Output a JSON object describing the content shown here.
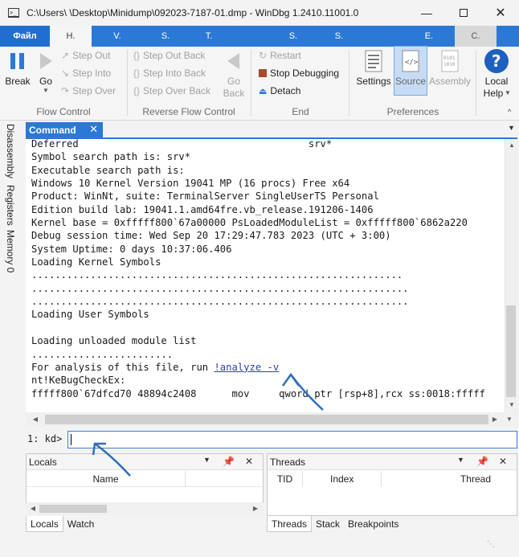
{
  "window": {
    "title": "C:\\Users\\        \\Desktop\\Minidump\\092023-7187-01.dmp - WinDbg 1.2410.11001.0"
  },
  "ribbon_tabs": {
    "file": "Файл",
    "tabs": [
      "Н.",
      "V.",
      "S.",
      "T.",
      "S.",
      "S.",
      "E.",
      "C."
    ]
  },
  "ribbon": {
    "flow_control": {
      "break": "Break",
      "go": "Go",
      "step_out": "Step Out",
      "step_into": "Step Into",
      "step_over": "Step Over",
      "group": "Flow Control"
    },
    "reverse_flow": {
      "step_out_back": "Step Out Back",
      "step_into_back": "Step Into Back",
      "step_over_back": "Step Over Back",
      "go_back_1": "Go",
      "go_back_2": "Back",
      "group": "Reverse Flow Control"
    },
    "end": {
      "restart": "Restart",
      "stop": "Stop Debugging",
      "detach": "Detach",
      "group": "End"
    },
    "preferences": {
      "settings": "Settings",
      "source": "Source",
      "assembly": "Assembly",
      "group": "Preferences"
    },
    "help": {
      "local_1": "Local",
      "local_2": "Help"
    }
  },
  "left_tabs": [
    "Disassembly",
    "Registers",
    "Memory 0"
  ],
  "command": {
    "tab_label": "Command",
    "lines": [
      "Deferred                                       srv*",
      "Symbol search path is: srv*",
      "Executable search path is:",
      "Windows 10 Kernel Version 19041 MP (16 procs) Free x64",
      "Product: WinNt, suite: TerminalServer SingleUserTS Personal",
      "Edition build lab: 19041.1.amd64fre.vb_release.191206-1406",
      "Kernel base = 0xfffff800`67a00000 PsLoadedModuleList = 0xfffff800`6862a220",
      "Debug session time: Wed Sep 20 17:29:47.783 2023 (UTC + 3:00)",
      "System Uptime: 0 days 10:37:06.406",
      "Loading Kernel Symbols",
      "...............................................................",
      "................................................................",
      "................................................................",
      "Loading User Symbols",
      "",
      "Loading unloaded module list",
      "........................"
    ],
    "analysis_prefix": "For analysis of this file, run ",
    "analysis_link": "!analyze -v",
    "bugcheck_line": "nt!KeBugCheckEx:",
    "disasm_line": "fffff800`67dfcd70 48894c2408      mov     qword ptr [rsp+8],rcx ss:0018:fffff",
    "prompt": "1: kd>",
    "input_value": ""
  },
  "locals_pane": {
    "title": "Locals",
    "col_name": "Name",
    "tabs": [
      "Locals",
      "Watch"
    ]
  },
  "threads_pane": {
    "title": "Threads",
    "col_tid": "TID",
    "col_index": "Index",
    "col_thread": "Thread",
    "tabs": [
      "Threads",
      "Stack",
      "Breakpoints"
    ]
  },
  "colors": {
    "accent": "#2b79d6",
    "annotation": "#2f6fb8",
    "link": "#2a3fb0"
  }
}
